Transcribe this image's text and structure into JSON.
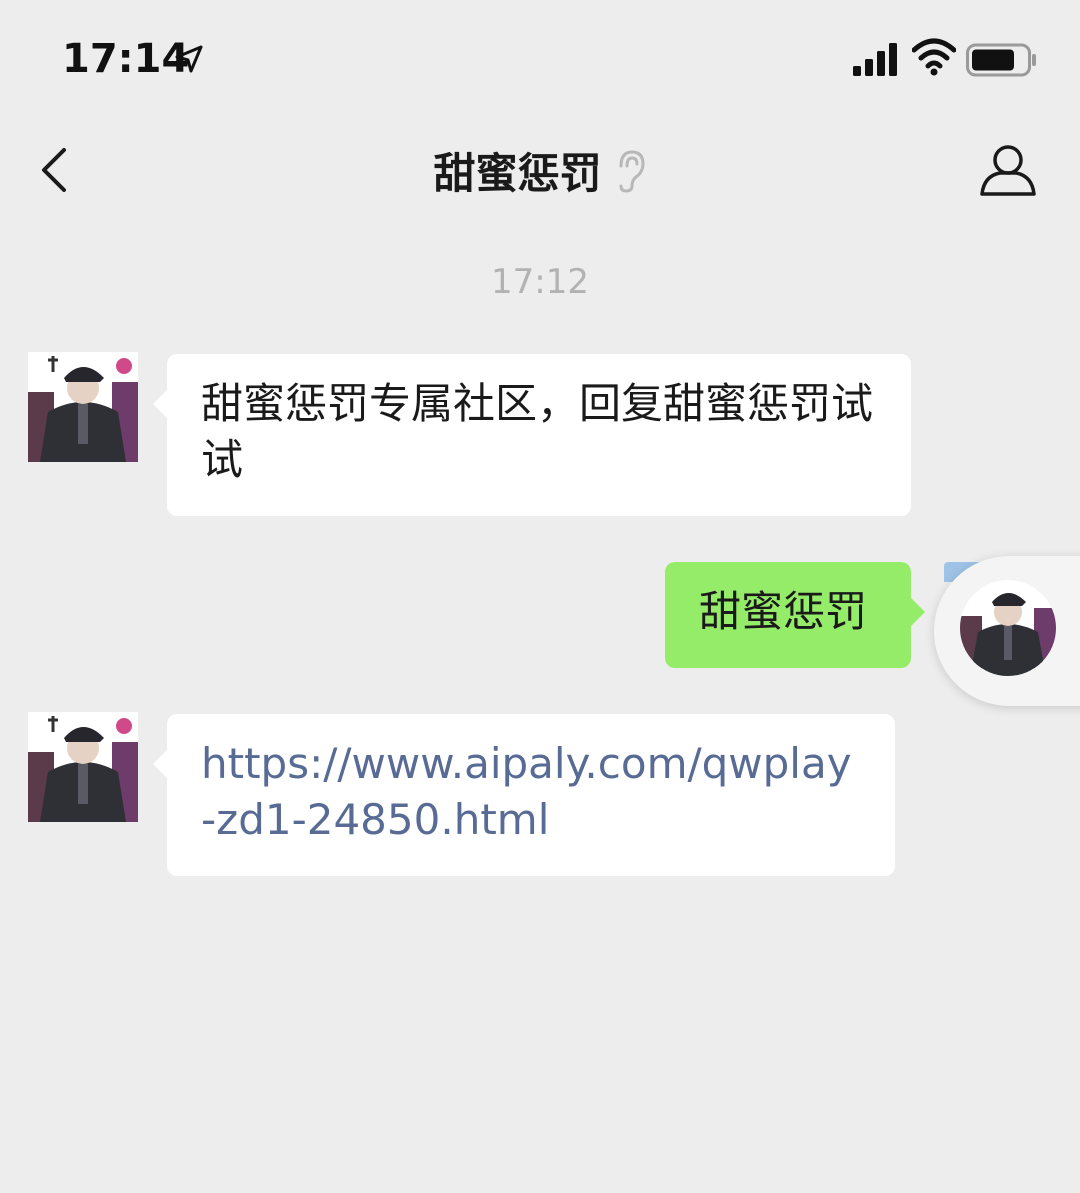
{
  "status_bar": {
    "time": "17:14",
    "icons": [
      "location-arrow-icon",
      "cellular-signal-icon",
      "wifi-icon",
      "battery-icon"
    ]
  },
  "nav": {
    "title": "甜蜜惩罚",
    "back_icon": "chevron-left-icon",
    "mute_icon": "mute-icon",
    "profile_icon": "person-icon"
  },
  "chat": {
    "timestamp": "17:12",
    "messages": [
      {
        "side": "left",
        "text": "甜蜜惩罚专属社区，回复甜蜜惩罚试试"
      },
      {
        "side": "right",
        "text": "甜蜜惩罚"
      },
      {
        "side": "left",
        "text": "https://www.aipaly.com/qwplay-zd1-24850.html",
        "is_link": true
      }
    ]
  },
  "colors": {
    "background": "#ededed",
    "bubble_incoming": "#ffffff",
    "bubble_outgoing": "#95ec69",
    "link": "#576b95",
    "timestamp": "#b2b2b2"
  }
}
